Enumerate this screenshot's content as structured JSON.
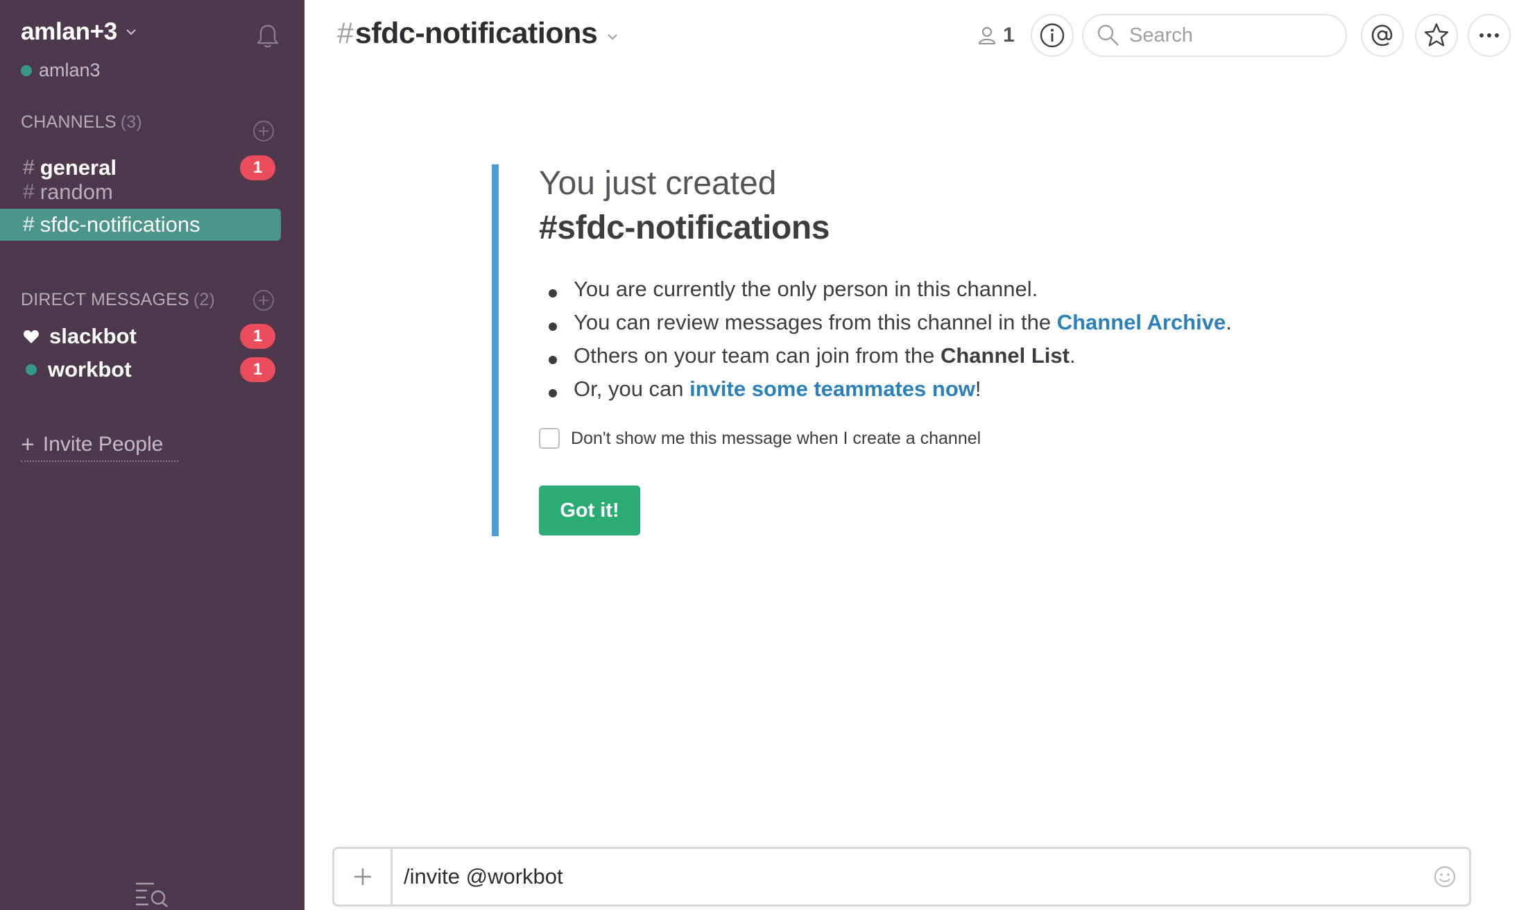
{
  "sidebar": {
    "team_name": "amlan+3",
    "user_name": "amlan3",
    "channels_header": "CHANNELS",
    "channels_count": "(3)",
    "channels": [
      {
        "name": "general",
        "unread": "1"
      },
      {
        "name": "random"
      },
      {
        "name": "sfdc-notifications"
      }
    ],
    "dm_header": "DIRECT MESSAGES",
    "dm_count": "(2)",
    "dms": [
      {
        "name": "slackbot",
        "unread": "1"
      },
      {
        "name": "workbot",
        "unread": "1"
      }
    ],
    "invite_label": "Invite People"
  },
  "header": {
    "channel_hash": "#",
    "channel_name": "sfdc-notifications",
    "member_count": "1",
    "search_placeholder": "Search"
  },
  "intro": {
    "line1": "You just created",
    "line2": "#sfdc-notifications",
    "b1": "You are currently the only person in this channel.",
    "b2_pre": "You can review messages from this channel in the ",
    "b2_link": "Channel Archive",
    "b2_post": ".",
    "b3_pre": "Others on your team can join from the ",
    "b3_bold": "Channel List",
    "b3_post": ".",
    "b4_pre": "Or, you can ",
    "b4_link": "invite some teammates now",
    "b4_post": "!",
    "optout_label": "Don't show me this message when I create a channel",
    "button_label": "Got it!"
  },
  "composer": {
    "value": "/invite @workbot"
  },
  "colors": {
    "sidebar_bg": "#4d394b",
    "active_channel": "#4c9689",
    "badge": "#eb4d5c",
    "accent_bar": "#4a9ddb",
    "link": "#2a80b9",
    "button": "#2bac76",
    "presence": "#38978d"
  }
}
